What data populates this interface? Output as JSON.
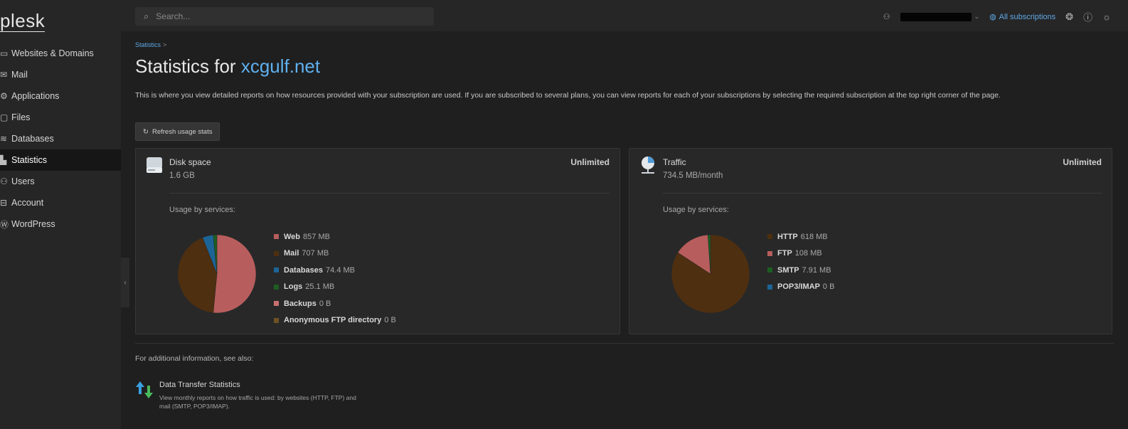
{
  "app": {
    "logo_text": "plesk"
  },
  "sidebar": {
    "items": [
      {
        "label": "Websites & Domains",
        "icon": "monitor-icon"
      },
      {
        "label": "Mail",
        "icon": "mail-icon"
      },
      {
        "label": "Applications",
        "icon": "gear-icon"
      },
      {
        "label": "Files",
        "icon": "folder-icon"
      },
      {
        "label": "Databases",
        "icon": "database-icon"
      },
      {
        "label": "Statistics",
        "icon": "bar-chart-icon",
        "active": true
      },
      {
        "label": "Users",
        "icon": "user-icon"
      },
      {
        "label": "Account",
        "icon": "account-icon"
      },
      {
        "label": "WordPress",
        "icon": "wordpress-icon"
      }
    ],
    "collapse_glyph": "‹"
  },
  "topbar": {
    "search_placeholder": "Search...",
    "subscriptions_label": "All subscriptions"
  },
  "page": {
    "breadcrumb": "Statistics",
    "breadcrumb_sep": ">",
    "title_prefix": "Statistics for ",
    "title_domain": "xcgulf.net",
    "description": "This is where you view detailed reports on how resources provided with your subscription are used. If you are subscribed to several plans, you can view reports for each of your subscriptions by selecting the required subscription at the top right corner of the page.",
    "refresh_label": "Refresh usage stats"
  },
  "disk": {
    "title": "Disk space",
    "value": "1.6 GB",
    "limit": "Unlimited",
    "usage_label": "Usage by services:",
    "services": [
      {
        "name": "Web",
        "value": "857 MB",
        "mb": 857,
        "color": "#b85d5d"
      },
      {
        "name": "Mail",
        "value": "707 MB",
        "mb": 707,
        "color": "#4e2f10"
      },
      {
        "name": "Databases",
        "value": "74.4 MB",
        "mb": 74.4,
        "color": "#1d6496"
      },
      {
        "name": "Logs",
        "value": "25.1 MB",
        "mb": 25.1,
        "color": "#1d5e22"
      },
      {
        "name": "Backups",
        "value": "0 B",
        "mb": 0,
        "color": "#c97070"
      },
      {
        "name": "Anonymous FTP directory",
        "value": "0 B",
        "mb": 0,
        "color": "#6e5224"
      }
    ]
  },
  "traffic": {
    "title": "Traffic",
    "value": "734.5 MB/month",
    "limit": "Unlimited",
    "usage_label": "Usage by services:",
    "services": [
      {
        "name": "HTTP",
        "value": "618 MB",
        "mb": 618,
        "color": "#4e2f10"
      },
      {
        "name": "FTP",
        "value": "108 MB",
        "mb": 108,
        "color": "#b85d5d"
      },
      {
        "name": "SMTP",
        "value": "7.91 MB",
        "mb": 7.91,
        "color": "#1d5e22"
      },
      {
        "name": "POP3/IMAP",
        "value": "0 B",
        "mb": 0,
        "color": "#1d6496"
      }
    ]
  },
  "see_also": {
    "heading": "For additional information, see also:",
    "link": "Data Transfer Statistics",
    "description": "View monthly reports on how traffic is used: by websites (HTTP, FTP) and mail (SMTP, POP3/IMAP)."
  }
}
